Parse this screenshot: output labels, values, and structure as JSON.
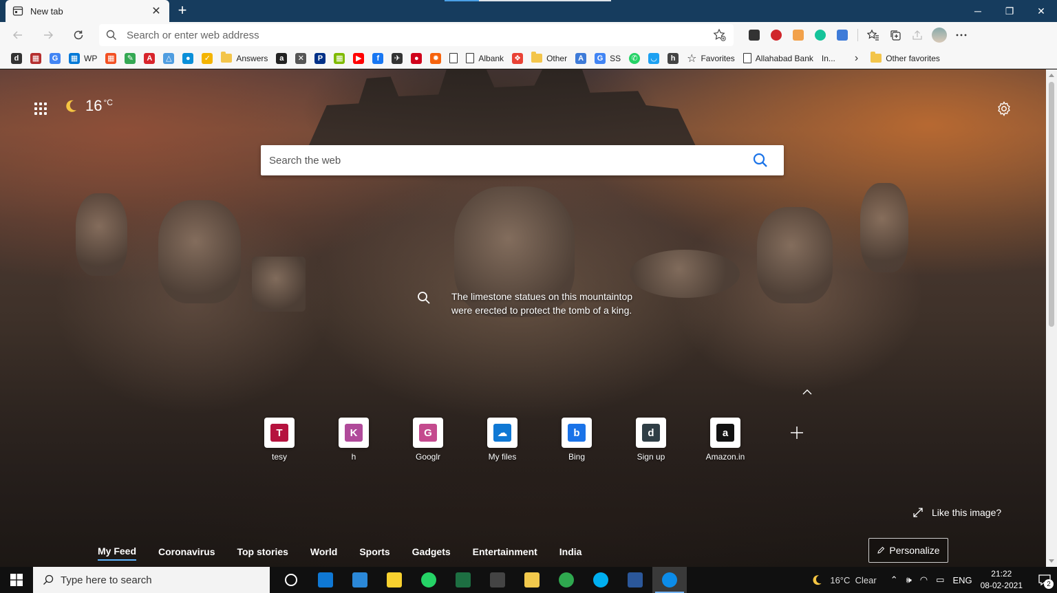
{
  "browser": {
    "tab_title": "New tab",
    "tab_close": "✕",
    "new_tab": "+",
    "window": {
      "minimize": "─",
      "restore": "❐",
      "close": "✕"
    }
  },
  "toolbar": {
    "address_placeholder": "Search or enter web address",
    "extensions": [
      "more-icon",
      "adblock-plus-icon",
      "rss-icon",
      "grammarly-icon",
      "translate-icon"
    ],
    "extension_colors": [
      "#333333",
      "#d0262b",
      "#f2a14a",
      "#15c39a",
      "#3e7bd8"
    ]
  },
  "bookmarks": {
    "items": [
      {
        "icon": "d",
        "label": "",
        "color": "#333333"
      },
      {
        "icon": "▦",
        "label": "",
        "color": "#b52f2f"
      },
      {
        "icon": "G",
        "label": "",
        "color": "#4285f4"
      },
      {
        "icon": "▦",
        "label": "WP",
        "color": "#0078d7"
      },
      {
        "icon": "▦",
        "label": "",
        "color": "#f25022"
      },
      {
        "icon": "✎",
        "label": "",
        "color": "#34a853"
      },
      {
        "icon": "A",
        "label": "",
        "color": "#d8242b"
      },
      {
        "icon": "△",
        "label": "",
        "color": "#4f9de0"
      },
      {
        "icon": "●",
        "label": "",
        "color": "#0a8fd8"
      },
      {
        "icon": "✓",
        "label": "",
        "color": "#f4b400"
      }
    ],
    "folder_answers": "Answers",
    "items2": [
      {
        "icon": "a",
        "label": "",
        "color": "#222222"
      },
      {
        "icon": "✕",
        "label": "",
        "color": "#555555"
      },
      {
        "icon": "P",
        "label": "",
        "color": "#003087"
      },
      {
        "icon": "▦",
        "label": "",
        "color": "#7fba00"
      },
      {
        "icon": "▶",
        "label": "",
        "color": "#ff0000"
      },
      {
        "icon": "f",
        "label": "",
        "color": "#1877f2"
      },
      {
        "icon": "✈",
        "label": "",
        "color": "#333333"
      },
      {
        "icon": "●",
        "label": "",
        "color": "#d0021b"
      },
      {
        "icon": "✹",
        "label": "",
        "color": "#f7630c"
      }
    ],
    "page_albank": "Albank",
    "folder_other": "Other",
    "item_ss": "SS",
    "favorites": "Favorites",
    "allahabad": "Allahabad Bank",
    "overflow": "In...",
    "other_favorites": "Other favorites"
  },
  "newtab": {
    "temperature": "16",
    "temp_unit": "°C",
    "search_placeholder": "Search the web",
    "caption": "The limestone statues on this mountaintop were erected to protect the tomb of a king.",
    "quick_links": [
      {
        "letter": "T",
        "label": "tesy",
        "color": "#b5123e"
      },
      {
        "letter": "K",
        "label": "h",
        "color": "#b04a9a"
      },
      {
        "letter": "G",
        "label": "Googlr",
        "color": "#c44a8e"
      },
      {
        "letter": "☁",
        "label": "My files",
        "color": "#0f78d4"
      },
      {
        "letter": "b",
        "label": "Bing",
        "color": "#1a73e8"
      },
      {
        "letter": "d",
        "label": "Sign up",
        "color": "#2f3e46"
      },
      {
        "letter": "a",
        "label": "Amazon.in",
        "color": "#111111"
      }
    ],
    "like_image": "Like this image?",
    "feed_tabs": [
      "My Feed",
      "Coronavirus",
      "Top stories",
      "World",
      "Sports",
      "Gadgets",
      "Entertainment",
      "India"
    ],
    "personalize": "Personalize"
  },
  "taskbar": {
    "search_placeholder": "Type here to search",
    "apps": [
      "cortana-icon",
      "mail-icon",
      "notepad-icon",
      "sticky-notes-icon",
      "whatsapp-icon",
      "excel-icon",
      "terminal-icon",
      "file-explorer-icon",
      "edge-dev-icon",
      "skype-icon",
      "word-icon",
      "edge-icon"
    ],
    "app_colors": [
      "#ffffff",
      "#0f78d4",
      "#2b88d8",
      "#f8d12f",
      "#25d366",
      "#1d6f42",
      "#444444",
      "#f2c94c",
      "#2fa84f",
      "#00aff0",
      "#2b579a",
      "#0c8ce9"
    ],
    "weather": "16°C  Clear",
    "language": "ENG",
    "time": "21:22",
    "date": "08-02-2021",
    "notification_count": "2"
  }
}
